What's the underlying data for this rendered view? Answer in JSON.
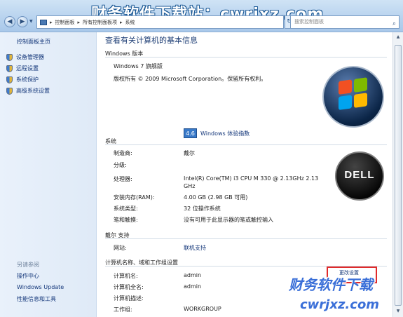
{
  "banner": "财务软件下载站：cwrjxz.com",
  "toolbar": {
    "address": [
      "控制面板",
      "所有控制面板项",
      "系统"
    ],
    "search_placeholder": "搜索控制面板"
  },
  "sidebar": {
    "home": "控制面板主页",
    "tasks": [
      "设备管理器",
      "远程设置",
      "系统保护",
      "高级系统设置"
    ],
    "see_also_title": "另请参阅",
    "see_also": [
      "操作中心",
      "Windows Update",
      "性能信息和工具"
    ]
  },
  "main": {
    "heading": "查看有关计算机的基本信息",
    "edition": {
      "title": "Windows 版本",
      "name": "Windows 7 旗舰版",
      "copyright": "版权所有 © 2009 Microsoft Corporation。保留所有权利。"
    },
    "system": {
      "title": "系统",
      "rows": [
        {
          "label": "制造商:",
          "value": "戴尔"
        },
        {
          "label": "分级:",
          "value": ""
        },
        {
          "label": "处理器:",
          "value": "Intel(R) Core(TM) i3 CPU       M 330  @ 2.13GHz   2.13",
          "value2": "GHz"
        },
        {
          "label": "安装内存(RAM):",
          "value": "4.00 GB (2.98 GB 可用)"
        },
        {
          "label": "系统类型:",
          "value": "32 位操作系统"
        },
        {
          "label": "笔和触摸:",
          "value": "没有可用于此显示器的笔或触控输入"
        }
      ],
      "score": "4.6",
      "score_link": "Windows 体验指数"
    },
    "support": {
      "title": "戴尔 支持",
      "website_label": "网站:",
      "website_link": "联机支持"
    },
    "computer": {
      "title": "计算机名称、域和工作组设置",
      "rows": [
        {
          "label": "计算机名:",
          "value": "admin"
        },
        {
          "label": "计算机全名:",
          "value": "admin"
        },
        {
          "label": "计算机描述:",
          "value": ""
        },
        {
          "label": "工作组:",
          "value": "WORKGROUP"
        }
      ],
      "change_settings": "更改设置"
    }
  },
  "watermark": {
    "line1": "财务软件下载",
    "line2": "cwrjxz.com"
  },
  "colors": {
    "link": "#14377a",
    "accent": "#3879c8",
    "highlight_box": "#e02b2b"
  }
}
